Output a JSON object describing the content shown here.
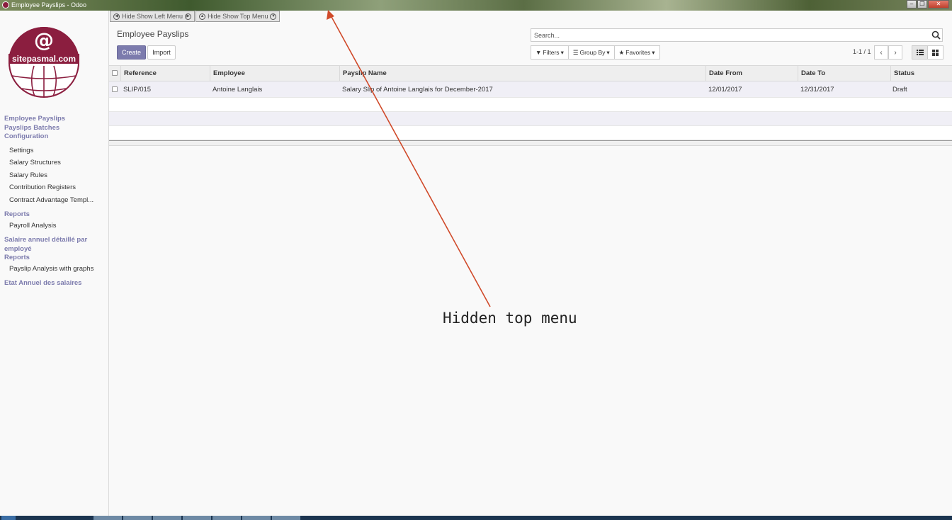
{
  "window": {
    "title": "Employee Payslips - Odoo",
    "controls": [
      "minimize",
      "restore",
      "close"
    ]
  },
  "toggles": {
    "left_menu": "Hide Show Left Menu",
    "top_menu": "Hide Show Top Menu"
  },
  "sidebar": {
    "logo_text": "sitepasmal.com",
    "menu": [
      {
        "type": "section",
        "label": "Employee Payslips"
      },
      {
        "type": "section",
        "label": "Payslips Batches"
      },
      {
        "type": "section",
        "label": "Configuration"
      },
      {
        "type": "item",
        "label": "Settings"
      },
      {
        "type": "item",
        "label": "Salary Structures"
      },
      {
        "type": "item",
        "label": "Salary Rules"
      },
      {
        "type": "item",
        "label": "Contribution Registers"
      },
      {
        "type": "item",
        "label": "Contract Advantage Templ..."
      },
      {
        "type": "section",
        "label": "Reports"
      },
      {
        "type": "item",
        "label": "Payroll Analysis"
      },
      {
        "type": "section",
        "label": "Salaire annuel détaillé par employé"
      },
      {
        "type": "section",
        "label": "Reports"
      },
      {
        "type": "item",
        "label": "Payslip Analysis with graphs"
      },
      {
        "type": "section",
        "label": "Etat Annuel des salaires"
      }
    ]
  },
  "control_panel": {
    "title": "Employee Payslips",
    "create_label": "Create",
    "import_label": "Import",
    "search_placeholder": "Search...",
    "filters_label": "Filters",
    "groupby_label": "Group By",
    "favorites_label": "Favorites",
    "pager": "1-1 / 1"
  },
  "table": {
    "columns": [
      "Reference",
      "Employee",
      "Payslip Name",
      "Date From",
      "Date To",
      "Status"
    ],
    "rows": [
      [
        "SLIP/015",
        "Antoine Langlais",
        "Salary Slip of Antoine Langlais for December-2017",
        "12/01/2017",
        "12/31/2017",
        "Draft"
      ]
    ]
  },
  "annotation": {
    "text": "Hidden top menu",
    "color": "#d04a2a"
  },
  "colors": {
    "accent": "#7c7bad",
    "brand": "#8b1e3f"
  }
}
